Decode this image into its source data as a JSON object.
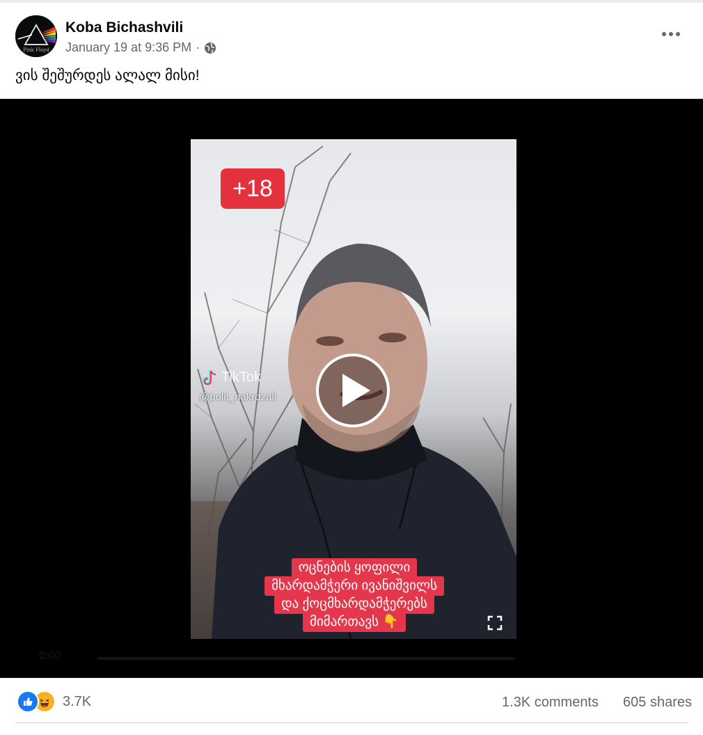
{
  "post": {
    "author": "Koba Bichashvili",
    "timestamp": "January 19 at 9:36 PM",
    "separator": "·",
    "privacy_icon": "globe-icon",
    "text": "ვის შეშურდეს ალალ მისი!",
    "avatar_text": "Pink Floyd"
  },
  "video": {
    "age_badge": "+18",
    "watermark_brand": "TikTok",
    "watermark_handle": "@polit_nakrdzali",
    "caption_lines": [
      "ოცნების ყოფილი",
      "მხარდამჭერი ივანიშვილს",
      "და ქოცმხარდამჭერებს",
      "მიმართავს 👇"
    ],
    "time": "0:00"
  },
  "stats": {
    "reactions_count": "3.7K",
    "reaction_icons": [
      "like-icon",
      "haha-icon"
    ],
    "comments": "1.3K comments",
    "shares": "605 shares"
  },
  "colors": {
    "facebook_blue": "#1877f2",
    "badge_red": "#e3313e",
    "caption_red": "#e5374c",
    "secondary_text": "#65676b"
  }
}
